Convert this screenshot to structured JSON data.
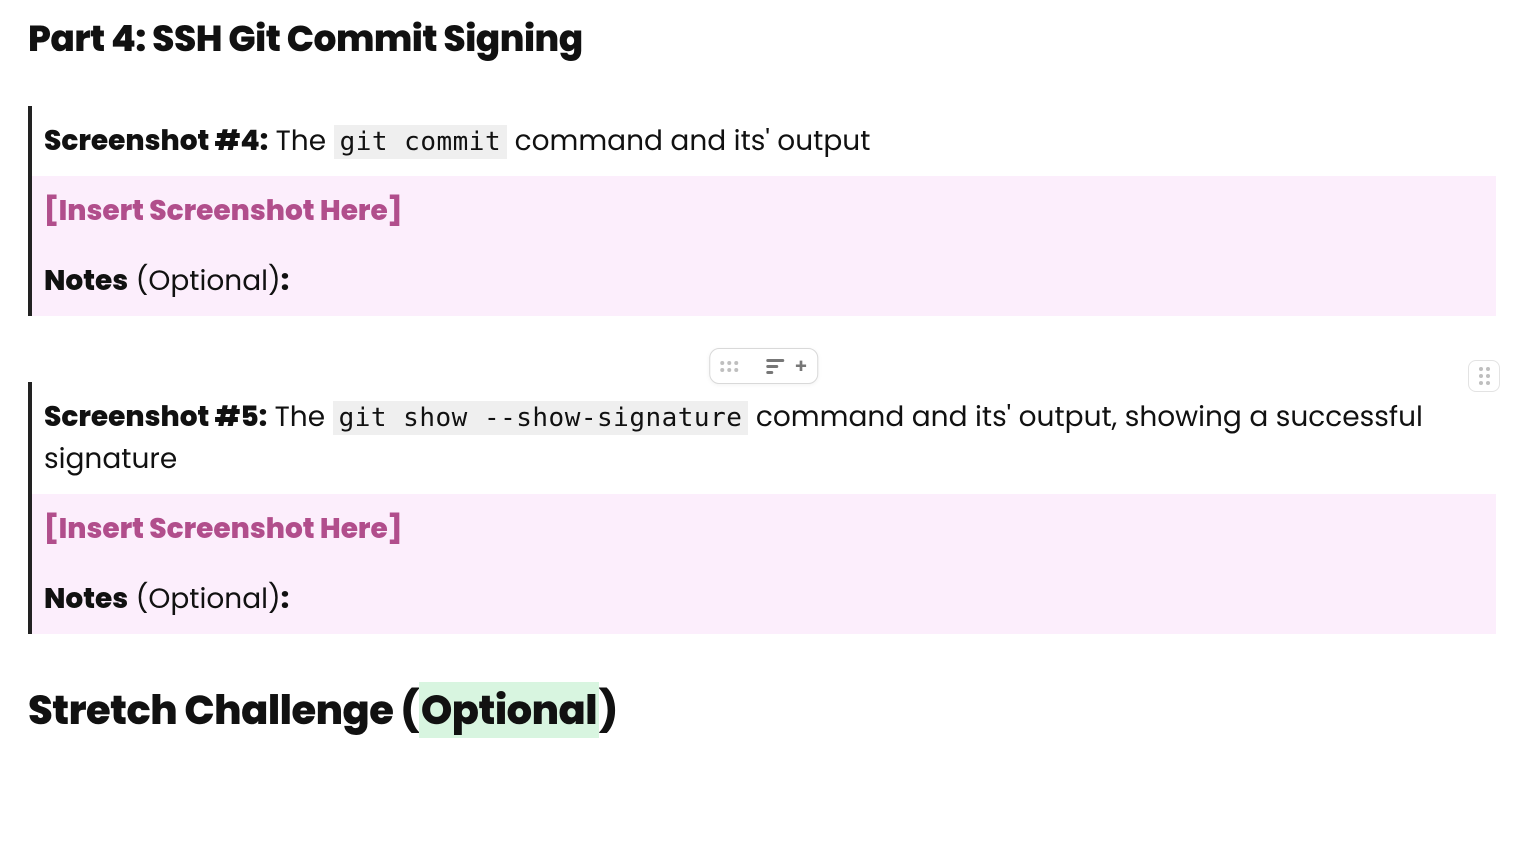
{
  "heading_part4": "Part 4: SSH Git Commit Signing",
  "block4": {
    "label": "Screenshot #4:",
    "desc_before": " The ",
    "code": "git commit",
    "desc_after": " command and its' output",
    "placeholder": "[Insert Screenshot Here]",
    "notes_label": "Notes",
    "notes_optional": " (Optional)",
    "notes_colon": ":"
  },
  "block5": {
    "label": "Screenshot #5:",
    "desc_before": " The ",
    "code": "git show --show-signature",
    "desc_after": " command and its' output, showing a successful signature",
    "placeholder": "[Insert Screenshot Here]",
    "notes_label": "Notes",
    "notes_optional": " (Optional)",
    "notes_colon": ":"
  },
  "stretch": {
    "before": "Stretch Challenge (",
    "highlight": "Optional",
    "after": ")"
  },
  "toolbar": {
    "plus": "+"
  }
}
